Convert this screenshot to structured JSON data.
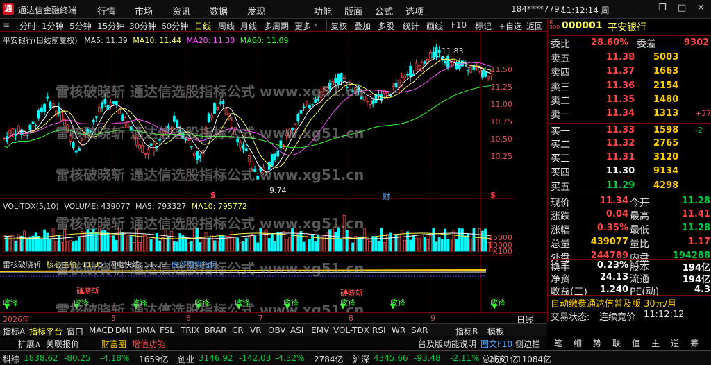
{
  "app": {
    "title": "通达信金融终端"
  },
  "menu": [
    "行情",
    "市场",
    "资讯",
    "数据",
    "发现",
    "功能",
    "版面",
    "公式",
    "选项"
  ],
  "account": "184****7797",
  "clock": "11:12:14 周一",
  "toolbar": {
    "left": [
      "分时",
      "1分钟",
      "5分钟",
      "15分钟",
      "30分钟",
      "60分钟",
      "日线",
      "周线",
      "月线",
      "多周期",
      "更多"
    ],
    "right": [
      "复权",
      "叠加",
      "多股",
      "统计",
      "画线",
      "F10",
      "标记",
      "+自选",
      "返回"
    ],
    "active": "日线"
  },
  "chart": {
    "main_legend": {
      "name": "平安银行(日线前复权)",
      "ma5": "MA5: 11.39",
      "ma10": "MA10: 11.44",
      "ma20": "MA20: 11.30",
      "ma60": "MA60: 11.09"
    },
    "price_ticks": [
      "11.50",
      "11.25",
      "11.00",
      "10.75",
      "10.50",
      "10.25"
    ],
    "high_mark": "11.83",
    "low_mark": "9.74",
    "s_marks": [
      "S",
      "S"
    ],
    "cai_mark": "财",
    "vol_legend": {
      "name": "VOL-TDX(5,10)",
      "volume": "VOLUME: 439077",
      "ma5": "MA5: 793327",
      "ma10": "MA10: 795772"
    },
    "vol_ticks": [
      "15000",
      "10000"
    ],
    "vol_unit": "X100",
    "ind_legend": {
      "name": "雷核破晓斩",
      "core": "核心主轨: 11.35",
      "flash": "闪电快线: 11.39",
      "strong": "底部强势指标"
    },
    "signal_breakdown": "破晓斩",
    "signal_buy": "收锋",
    "months": [
      "2026年",
      "5",
      "6",
      "7",
      "8",
      "9"
    ],
    "watermark": "雷核破晓斩 通达信选股指标公式 www.xg51.cn"
  },
  "quote": {
    "code": "000001",
    "name": "平安银行",
    "weibi_label": "委比",
    "weibi": "28.60%",
    "weicha_label": "委差",
    "weicha": "9302",
    "sells": [
      {
        "label": "卖五",
        "price": "11.38",
        "vol": "5003",
        "chg": ""
      },
      {
        "label": "卖四",
        "price": "11.37",
        "vol": "1663",
        "chg": ""
      },
      {
        "label": "卖三",
        "price": "11.36",
        "vol": "2154",
        "chg": ""
      },
      {
        "label": "卖二",
        "price": "11.35",
        "vol": "1480",
        "chg": ""
      },
      {
        "label": "卖一",
        "price": "11.34",
        "vol": "1313",
        "chg": "+27"
      }
    ],
    "buys": [
      {
        "label": "买一",
        "price": "11.33",
        "vol": "1598",
        "chg": "-2"
      },
      {
        "label": "买二",
        "price": "11.32",
        "vol": "2765",
        "chg": ""
      },
      {
        "label": "买三",
        "price": "11.31",
        "vol": "3120",
        "chg": ""
      },
      {
        "label": "买四",
        "price": "11.30",
        "vol": "9134",
        "chg": ""
      },
      {
        "label": "买五",
        "price": "11.29",
        "vol": "4298",
        "chg": ""
      }
    ],
    "stats": [
      {
        "l1": "现价",
        "v1": "11.34",
        "c1": "red",
        "l2": "今开",
        "v2": "11.28",
        "c2": "green"
      },
      {
        "l1": "涨跌",
        "v1": "0.04",
        "c1": "red",
        "l2": "最高",
        "v2": "11.41",
        "c2": "red"
      },
      {
        "l1": "涨幅",
        "v1": "0.35%",
        "c1": "red",
        "l2": "最低",
        "v2": "11.28",
        "c2": "green"
      },
      {
        "l1": "总量",
        "v1": "439077",
        "c1": "yellow",
        "l2": "量比",
        "v2": "1.17",
        "c2": "red"
      },
      {
        "l1": "外盘",
        "v1": "244789",
        "c1": "red",
        "l2": "内盘",
        "v2": "194288",
        "c2": "green"
      }
    ],
    "stats2": [
      {
        "l1": "换手",
        "v1": "0.23%",
        "l2": "股本",
        "v2": "194亿"
      },
      {
        "l1": "净资",
        "v1": "24.13",
        "l2": "流通",
        "v2": "194亿"
      },
      {
        "l1": "收益(三)",
        "v1": "1.240",
        "l2": "PE(动)",
        "v2": "4.3"
      }
    ],
    "promo": "自动缴费通达信普及版 30元/月",
    "trade_state_label": "交易状态:",
    "trade_state": "连续竞价",
    "trade_time": "11:12:12"
  },
  "tabs": [
    "指标A",
    "指标平台",
    "窗口",
    "MACD",
    "DMI",
    "DMA",
    "FSL",
    "TRIX",
    "BRAR",
    "CR",
    "VR",
    "OBV",
    "ASI",
    "EMV",
    "VOL-TDX",
    "RSI",
    "WR",
    "SAR",
    "指标B",
    "模板"
  ],
  "subbar": [
    "扩展∧",
    "关联报价",
    "财富圈",
    "增值功能",
    "普及版功能说明",
    "图文F10",
    "侧边栏"
  ],
  "period_right": "日线",
  "tradebar_icons": [
    "笔",
    "细",
    "势",
    "联",
    "值",
    "主",
    "逆",
    "筹"
  ],
  "status": [
    {
      "label": "科综",
      "value": "1838.62",
      "chg": "-80.25",
      "pct": "-4.18%",
      "amt": "1659亿"
    },
    {
      "label": "创业",
      "value": "3146.92",
      "chg": "-142.03",
      "pct": "-4.32%",
      "amt": "2784亿"
    },
    {
      "label": "沪深",
      "value": "4345.66",
      "chg": "-93.48",
      "pct": "-2.11%",
      "amt": "2661亿"
    }
  ],
  "total_label": "总成交",
  "total_value": "11084亿",
  "colors": {
    "up": "#ff4444",
    "down": "#00ffff",
    "border": "#8b0000"
  }
}
